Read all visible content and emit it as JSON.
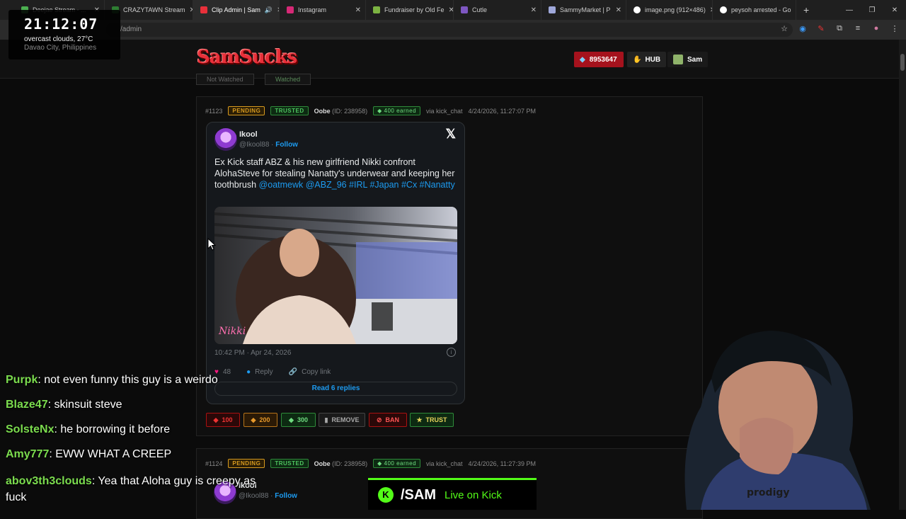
{
  "browser": {
    "tabs": [
      {
        "label": "Deejae Stream - ...",
        "color": "#4caf50"
      },
      {
        "label": "CRAZYTAWN Stream",
        "color": "#2e7d32"
      },
      {
        "label": "Clip Admin | Sam",
        "color": "#e8303a",
        "active": true
      },
      {
        "label": "Instagram",
        "color": "#d62976"
      },
      {
        "label": "Fundraiser by Old Fe",
        "color": "#7cb342"
      },
      {
        "label": "Cutle",
        "color": "#7e57c2"
      },
      {
        "label": "SammyMarket | P",
        "color": "#9fa8da"
      },
      {
        "label": "image.png (912×486)",
        "color": "#ffffff"
      },
      {
        "label": "peysoh arrested - Go",
        "color": "#ffffff"
      }
    ],
    "address": "/admin"
  },
  "clock": {
    "time": "21:12:07",
    "weather": "overcast clouds, 27°C",
    "location": "Davao City, Philippines"
  },
  "site": {
    "logo": "SamSucks",
    "points": "8953647",
    "hub": "HUB",
    "user": "Sam",
    "filters": [
      "Not Watched",
      "Watched"
    ]
  },
  "clips": [
    {
      "id": "#1123",
      "status": "PENDING",
      "trust": "TRUSTED",
      "user": "Oobe",
      "user_id": "(ID: 238958)",
      "earned": "400 earned",
      "via": "via kick_chat",
      "date": "4/24/2026, 11:27:07 PM"
    },
    {
      "id": "#1124",
      "status": "PENDING",
      "trust": "TRUSTED",
      "user": "Oobe",
      "user_id": "(ID: 238958)",
      "earned": "400 earned",
      "via": "via kick_chat",
      "date": "4/24/2026, 11:27:39 PM"
    }
  ],
  "tweet": {
    "name": "Ikool",
    "handle": "@Ikool88",
    "follow": "Follow",
    "text_plain": "Ex Kick staff ABZ & his new girlfriend Nikki confront AlohaSteve for stealing Nanatty's underwear and keeping her toothbrush",
    "text_links": "@oatmewk @ABZ_96 #IRL #Japan #Cx #Nanatty",
    "timestamp": "10:42 PM · Apr 24, 2026",
    "likes": "48",
    "reply": "Reply",
    "copy": "Copy link",
    "replies": "Read 6 replies"
  },
  "actions": {
    "b100": "100",
    "b200": "200",
    "b300": "300",
    "remove": "REMOVE",
    "ban": "BAN",
    "trust": "TRUST"
  },
  "chat": [
    {
      "user": "Purpk",
      "msg": ": not even funny this guy is a weirdo"
    },
    {
      "user": "Blaze47",
      "msg": ": skinsuit steve"
    },
    {
      "user": "SolsteNx",
      "msg": ": he borrowing it before"
    },
    {
      "user": "Amy777",
      "msg": ": EWW WHAT A CREEP"
    },
    {
      "user": "abov3th3clouds",
      "msg": ": Yea that Aloha guy is creepy as fuck"
    }
  ],
  "live": {
    "badge": "K",
    "channel": "/SAM",
    "text": "Live on Kick"
  },
  "colors": {
    "accent_red": "#a5121d",
    "kick_green": "#53fc18",
    "twitter_blue": "#1d9bf0"
  }
}
